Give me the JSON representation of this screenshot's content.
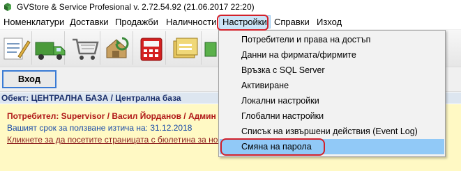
{
  "window": {
    "title": "GVStore & Service Profesional v. 2.72.54.92 (21.06.2017 22:20)"
  },
  "menubar": {
    "items": [
      {
        "label": "Номенклатури"
      },
      {
        "label": "Доставки"
      },
      {
        "label": "Продажби"
      },
      {
        "label": "Наличности"
      },
      {
        "label": "Настройки",
        "active": true
      },
      {
        "label": "Справки"
      },
      {
        "label": "Изход"
      }
    ]
  },
  "toolbar": {
    "icons": [
      "document-edit-icon",
      "delivery-truck-icon",
      "shopping-cart-icon",
      "warehouse-refresh-icon",
      "calculator-icon",
      "folders-icon",
      "settings-green-icon"
    ]
  },
  "toolbar2": {
    "login_label": "Вход"
  },
  "object_bar": {
    "text": "Обект: ЦЕНТРАЛНА БАЗА / Централна база"
  },
  "info_panel": {
    "user_text": "Потребител: Supervisor / Васил Йорданов / Админ",
    "expiry_text": "Вашият срок за ползване изтича на: 31.12.2018",
    "news_link": "Кликнете за да посетите страницата с бюлетина за новост"
  },
  "settings_menu": {
    "items": [
      {
        "label": "Потребители и права на достъп"
      },
      {
        "label": "Данни на фирмата/фирмите"
      },
      {
        "label": "Връзка с SQL Server"
      },
      {
        "label": "Активиране"
      },
      {
        "label": "Локални настройки"
      },
      {
        "label": "Глобални настройки"
      },
      {
        "label": "Списък на извършени действия (Event Log)"
      },
      {
        "label": "Смяна на парола",
        "selected": true
      }
    ]
  },
  "colors": {
    "highlight_oval": "#d2202a",
    "selected_item_bg": "#91c9f7",
    "info_bg": "#fff9c4",
    "user_text": "#b01818",
    "expiry_text": "#1a4ba8"
  }
}
